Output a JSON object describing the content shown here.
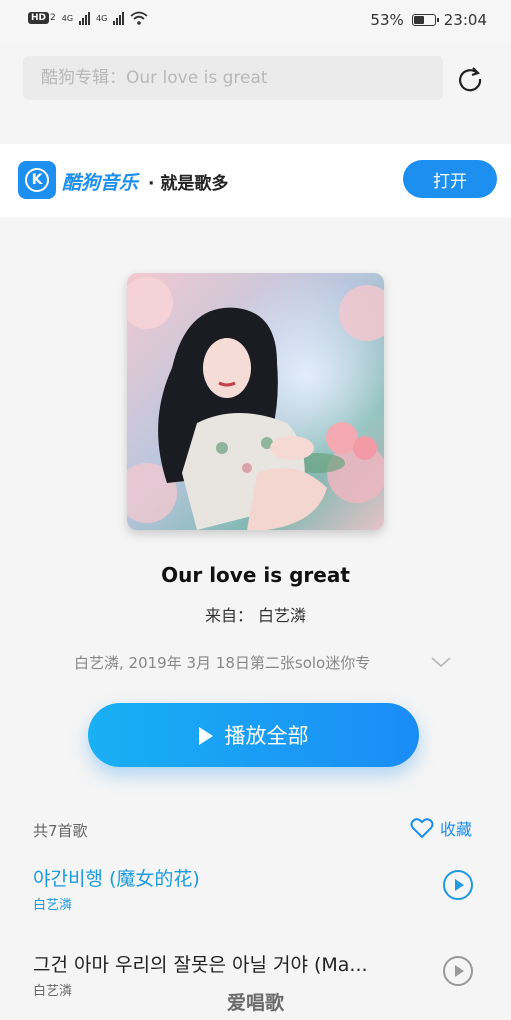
{
  "status_bar": {
    "hd": "HD",
    "sim": "2",
    "net1": "4G",
    "net2": "4G",
    "battery_percent": "53%",
    "battery_level": 0.53,
    "time": "23:04"
  },
  "search": {
    "placeholder": "酷狗专辑：Our love is great"
  },
  "banner": {
    "logo_letter": "K",
    "brand": "酷狗音乐",
    "slogan": "· 就是歌多",
    "open_label": "打开"
  },
  "album": {
    "title": "Our love is great",
    "from_line": "来自：  白艺潾",
    "description": "白艺潾, 2019年 3月 18日第二张solo迷你专",
    "play_all_label": "播放全部"
  },
  "tracklist": {
    "count_label": "共7首歌",
    "favorite_label": "收藏",
    "songs": [
      {
        "name": "야간비행 (魔女的花)",
        "artist": "白艺潾",
        "active": true
      },
      {
        "name": "그건 아마 우리의 잘못은 아닐 거야 (Ma...",
        "artist": "白艺潾",
        "active": false
      }
    ]
  },
  "watermark": "爱唱歌",
  "colors": {
    "accent": "#1d8ff0",
    "active_song": "#1d9ae0",
    "background": "#f5f5f5"
  }
}
